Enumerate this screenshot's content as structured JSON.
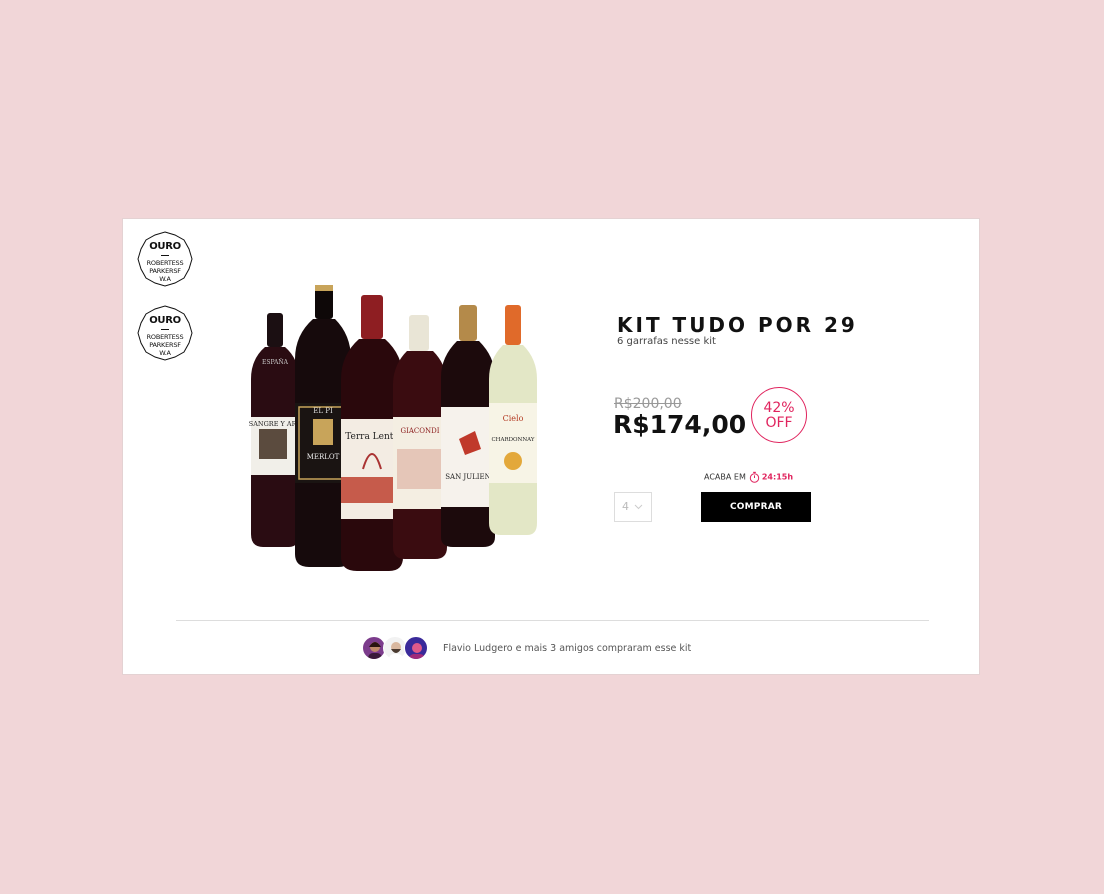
{
  "awards": [
    {
      "title": "OURO",
      "line1": "ROBERTESS",
      "line2": "PARKERSF",
      "line3": "W.A"
    },
    {
      "title": "OURO",
      "line1": "ROBERTESS",
      "line2": "PARKERSF",
      "line3": "W.A"
    }
  ],
  "bottle_labels": [
    "ESPAÑA",
    "SANGRE Y ARE",
    "MERLOT",
    "Terra Lenta",
    "GIACONDI",
    "SAN JULIEN",
    "Cielo",
    "CHARDONNAY"
  ],
  "product": {
    "title": "KIT TUDO POR 29",
    "subtitle": "6 garrafas nesse kit",
    "old_price": "R$200,00",
    "new_price": "R$174,00",
    "discount_pct": "42%",
    "discount_off": "OFF"
  },
  "offer": {
    "ends_label": "ACABA EM",
    "timer": "24:15h"
  },
  "quantity": {
    "value": "4"
  },
  "buy_button": {
    "label": "COMPRAR"
  },
  "social": {
    "text": "Flavio Ludgero e mais 3  amigos compraram esse kit"
  },
  "colors": {
    "background": "#f1d6d8",
    "accent": "#e0245e",
    "button": "#000000"
  }
}
